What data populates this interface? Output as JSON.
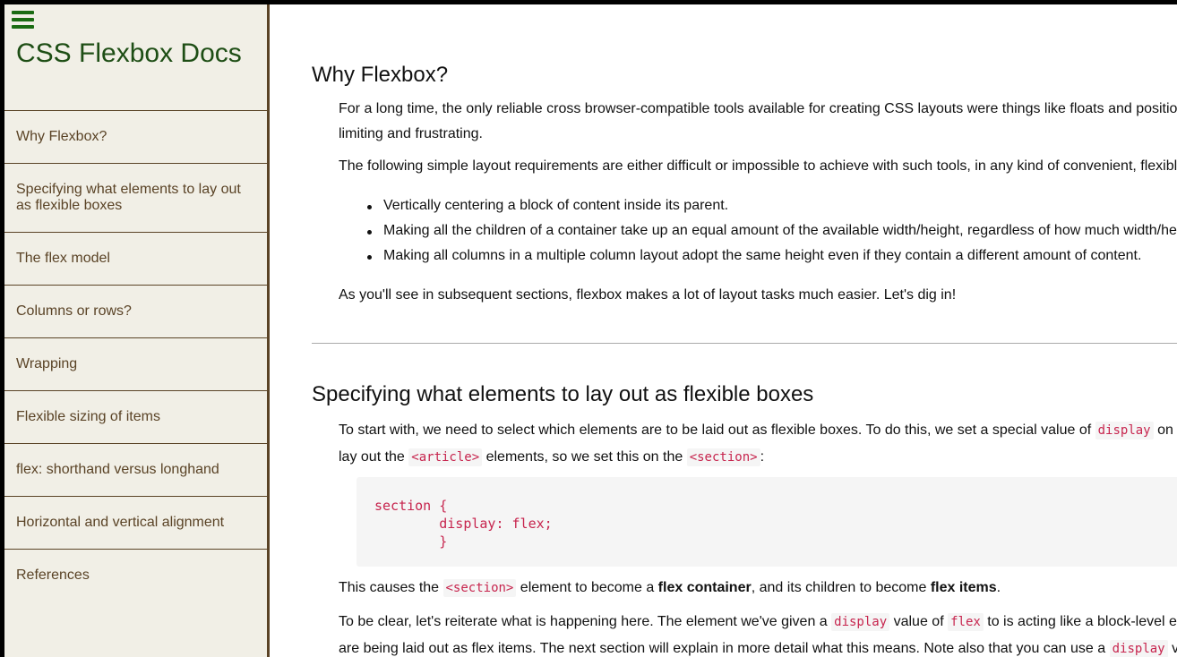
{
  "sidebar": {
    "title": "CSS Flexbox Docs",
    "menu_icon": "hamburger-menu-icon",
    "nav_items": [
      {
        "label": "Why Flexbox?"
      },
      {
        "label": "Specifying what elements to lay out as flexible boxes"
      },
      {
        "label": "The flex model"
      },
      {
        "label": "Columns or rows?"
      },
      {
        "label": "Wrapping"
      },
      {
        "label": "Flexible sizing of items"
      },
      {
        "label": "flex: shorthand versus longhand"
      },
      {
        "label": "Horizontal and vertical alignment"
      },
      {
        "label": "References"
      }
    ]
  },
  "colors": {
    "sidebar_bg": "#f1efe6",
    "sidebar_border": "#5a4326",
    "title_green": "#1e4e15",
    "menu_icon_green": "#1a6b12",
    "code_red": "#c7254e",
    "code_bg": "#f5f5f5"
  },
  "main": {
    "section1": {
      "heading": "Why Flexbox?",
      "p1_line1": "For a long time, the only reliable cross browser-compatible tools available for creating CSS layouts were things like floats and positioning",
      "p1_line2": "limiting and frustrating.",
      "p2": "The following simple layout requirements are either difficult or impossible to achieve with such tools, in any kind of convenient, flexible way:",
      "bullets": [
        "Vertically centering a block of content inside its parent.",
        "Making all the children of a container take up an equal amount of the available width/height, regardless of how much width/height is available.",
        "Making all columns in a multiple column layout adopt the same height even if they contain a different amount of content."
      ],
      "p3": "As you'll see in subsequent sections, flexbox makes a lot of layout tasks much easier. Let's dig in!"
    },
    "section2": {
      "heading": "Specifying what elements to lay out as flexible boxes",
      "p1_a": "To start with, we need to select which elements are to be laid out as flexible boxes. To do this, we set a special value of ",
      "p1_code1": "display",
      "p1_b": " on",
      "p1_line2_a": "lay out the ",
      "p1_code2": "<article>",
      "p1_line2_b": " elements, so we set this on the ",
      "p1_code3": "<section>",
      "p1_line2_c": ":",
      "code_block": "section {\n        display: flex;\n        }",
      "p2_a": "This causes the ",
      "p2_code": "<section>",
      "p2_b": " element to become a ",
      "p2_strong1": "flex container",
      "p2_c": ", and its children to become ",
      "p2_strong2": "flex items",
      "p2_d": ".",
      "p3_a": "To be clear, let's reiterate what is happening here. The element we've given a ",
      "p3_code1": "display",
      "p3_b": " value of ",
      "p3_code2": "flex",
      "p3_c": " to is acting like a block-level element",
      "p3_line2_a": "are being laid out as flex items. The next section will explain in more detail what this means. Note also that you can use a ",
      "p3_line2_code": "display",
      "p3_line2_b": " value"
    }
  }
}
